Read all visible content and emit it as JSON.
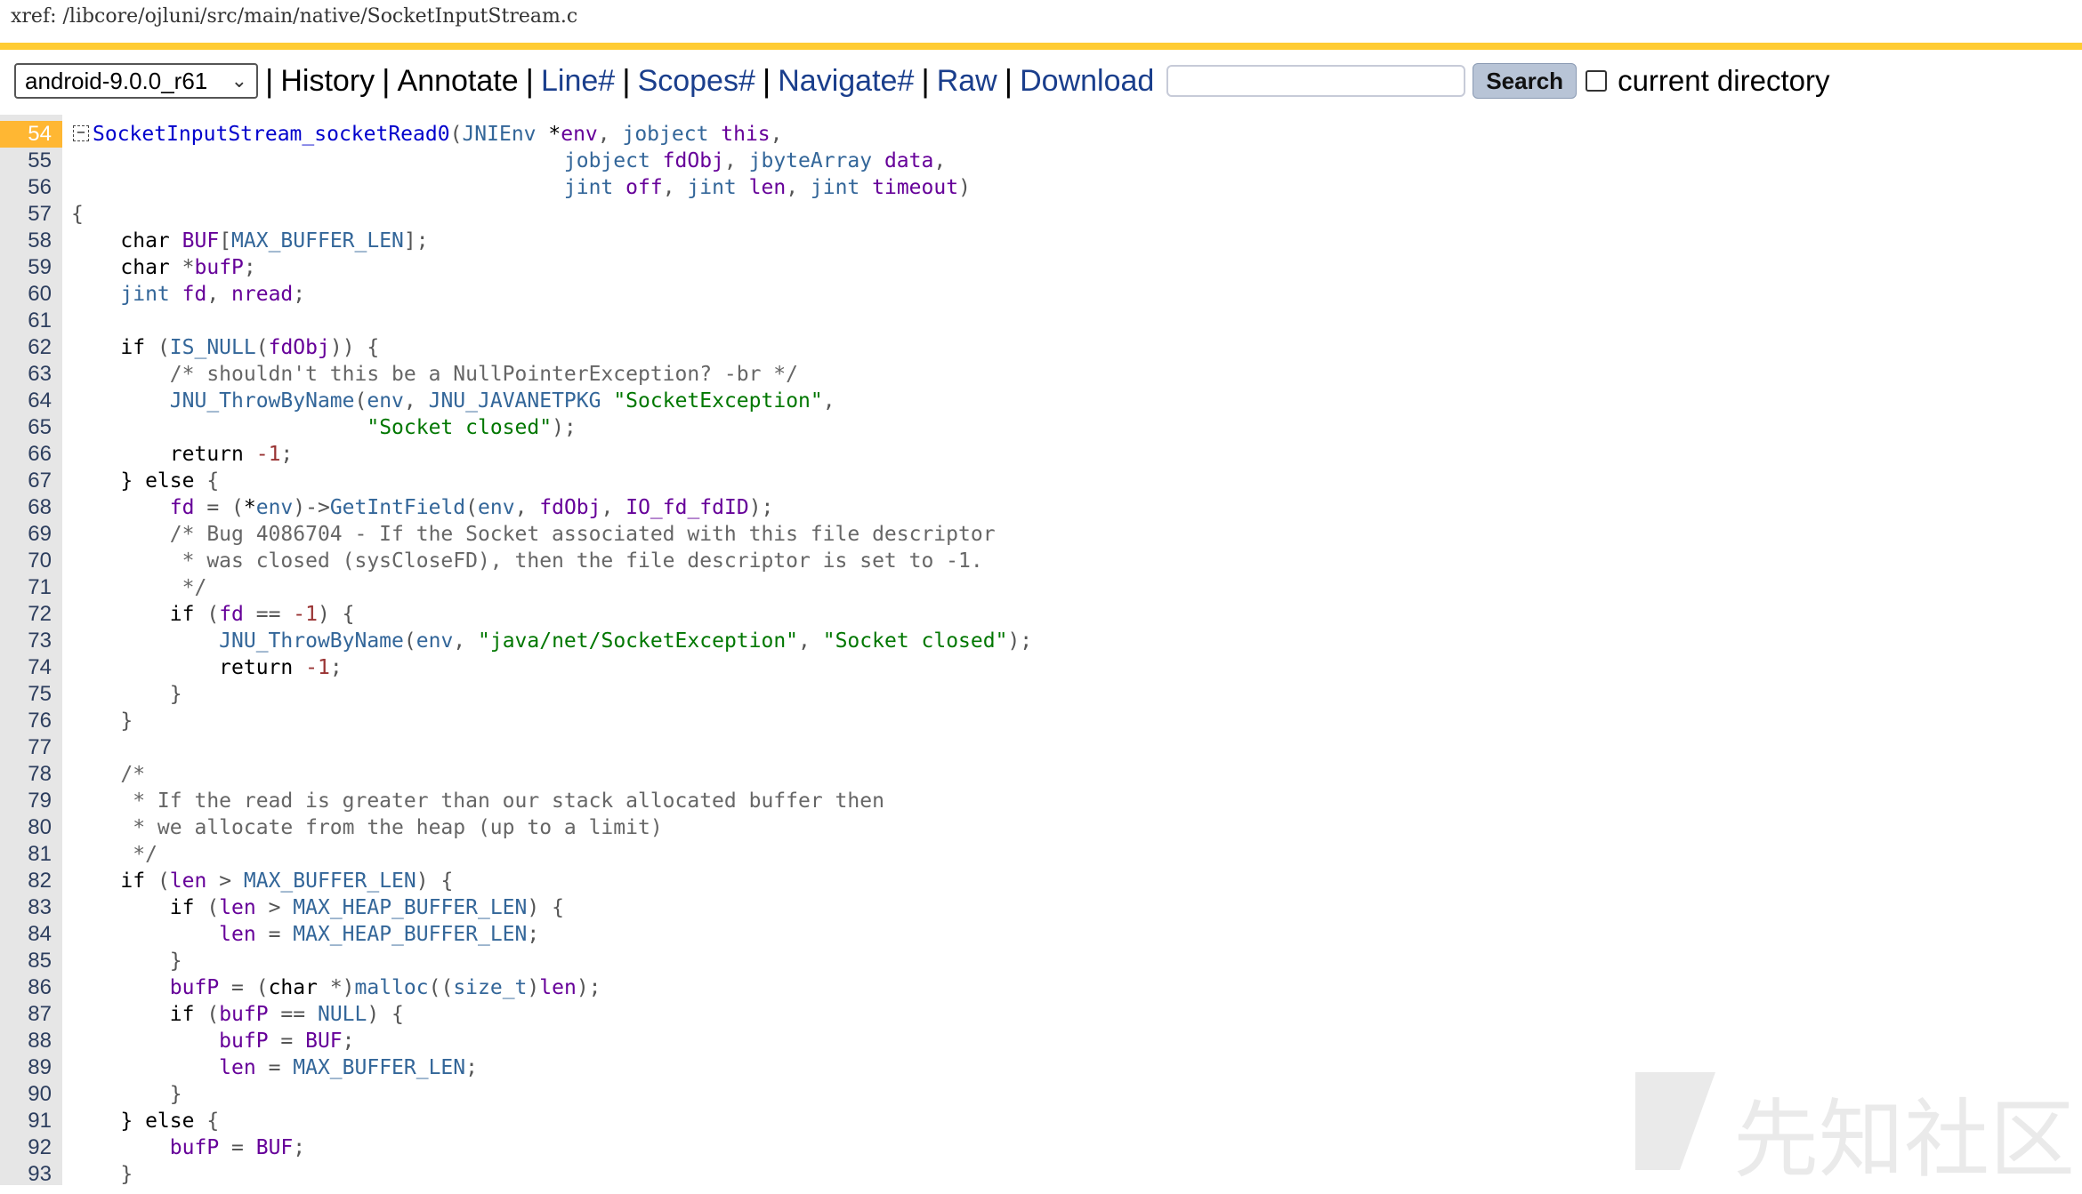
{
  "header": {
    "xref_path": "xref: /libcore/ojluni/src/main/native/SocketInputStream.c"
  },
  "nav": {
    "project_selected": "android-9.0.0_r61",
    "items": [
      "History",
      "Annotate"
    ],
    "links": [
      "Line#",
      "Scopes#",
      "Navigate#",
      "Raw",
      "Download"
    ],
    "search_placeholder": "",
    "search_button": "Search",
    "current_directory_label": "current directory"
  },
  "colors": {
    "accent_bar": "#ffcc33",
    "highlight_line": "#ffb733",
    "link": "#1a3e8c"
  },
  "code": {
    "highlight_line": 54,
    "lines": [
      {
        "n": "54",
        "tokens": [
          [
            "def",
            "SocketInputStream_socketRead0"
          ],
          [
            "pun",
            "("
          ],
          [
            "typ",
            "JNIEnv"
          ],
          [
            "kw",
            " *"
          ],
          [
            "id",
            "env"
          ],
          [
            "pun",
            ", "
          ],
          [
            "typ",
            "jobject "
          ],
          [
            "id",
            "this"
          ],
          [
            "pun",
            ","
          ]
        ]
      },
      {
        "n": "55",
        "tokens": [
          [
            "pun",
            "                                        "
          ],
          [
            "typ",
            "jobject "
          ],
          [
            "id",
            "fdObj"
          ],
          [
            "pun",
            ", "
          ],
          [
            "typ",
            "jbyteArray "
          ],
          [
            "id",
            "data"
          ],
          [
            "pun",
            ","
          ]
        ]
      },
      {
        "n": "56",
        "tokens": [
          [
            "pun",
            "                                        "
          ],
          [
            "typ",
            "jint "
          ],
          [
            "id",
            "off"
          ],
          [
            "pun",
            ", "
          ],
          [
            "typ",
            "jint "
          ],
          [
            "id",
            "len"
          ],
          [
            "pun",
            ", "
          ],
          [
            "typ",
            "jint "
          ],
          [
            "id",
            "timeout"
          ],
          [
            "pun",
            ")"
          ]
        ]
      },
      {
        "n": "57",
        "tokens": [
          [
            "pun",
            "{"
          ]
        ]
      },
      {
        "n": "58",
        "tokens": [
          [
            "pun",
            "    "
          ],
          [
            "kw",
            "char "
          ],
          [
            "id",
            "BUF"
          ],
          [
            "pun",
            "["
          ],
          [
            "mac",
            "MAX_BUFFER_LEN"
          ],
          [
            "pun",
            "];"
          ]
        ]
      },
      {
        "n": "59",
        "tokens": [
          [
            "pun",
            "    "
          ],
          [
            "kw",
            "char "
          ],
          [
            "pun",
            "*"
          ],
          [
            "id",
            "bufP"
          ],
          [
            "pun",
            ";"
          ]
        ]
      },
      {
        "n": "60",
        "tokens": [
          [
            "pun",
            "    "
          ],
          [
            "typ",
            "jint "
          ],
          [
            "id",
            "fd"
          ],
          [
            "pun",
            ", "
          ],
          [
            "id",
            "nread"
          ],
          [
            "pun",
            ";"
          ]
        ]
      },
      {
        "n": "61",
        "tokens": [
          [
            "pun",
            " "
          ]
        ]
      },
      {
        "n": "62",
        "tokens": [
          [
            "pun",
            "    "
          ],
          [
            "kw",
            "if "
          ],
          [
            "pun",
            "("
          ],
          [
            "mac",
            "IS_NULL"
          ],
          [
            "pun",
            "("
          ],
          [
            "id",
            "fdObj"
          ],
          [
            "pun",
            ")) {"
          ]
        ]
      },
      {
        "n": "63",
        "tokens": [
          [
            "pun",
            "        "
          ],
          [
            "com",
            "/* shouldn't this be a NullPointerException? -br */"
          ]
        ]
      },
      {
        "n": "64",
        "tokens": [
          [
            "pun",
            "        "
          ],
          [
            "mac",
            "JNU_ThrowByName"
          ],
          [
            "pun",
            "("
          ],
          [
            "typ",
            "env"
          ],
          [
            "pun",
            ", "
          ],
          [
            "mac",
            "JNU_JAVANETPKG "
          ],
          [
            "str",
            "\"SocketException\""
          ],
          [
            "pun",
            ","
          ]
        ]
      },
      {
        "n": "65",
        "tokens": [
          [
            "pun",
            "                        "
          ],
          [
            "str",
            "\"Socket closed\""
          ],
          [
            "pun",
            ");"
          ]
        ]
      },
      {
        "n": "66",
        "tokens": [
          [
            "pun",
            "        "
          ],
          [
            "kw",
            "return "
          ],
          [
            "num",
            "-1"
          ],
          [
            "pun",
            ";"
          ]
        ]
      },
      {
        "n": "67",
        "tokens": [
          [
            "pun",
            "    "
          ],
          [
            "kw",
            "} else "
          ],
          [
            "pun",
            "{"
          ]
        ]
      },
      {
        "n": "68",
        "tokens": [
          [
            "pun",
            "        "
          ],
          [
            "id",
            "fd"
          ],
          [
            "pun",
            " = ("
          ],
          [
            "kw",
            "*"
          ],
          [
            "typ",
            "env"
          ],
          [
            "pun",
            ")->"
          ],
          [
            "mac",
            "GetIntField"
          ],
          [
            "pun",
            "("
          ],
          [
            "typ",
            "env"
          ],
          [
            "pun",
            ", "
          ],
          [
            "id",
            "fdObj"
          ],
          [
            "pun",
            ", "
          ],
          [
            "id",
            "IO_fd_fdID"
          ],
          [
            "pun",
            ");"
          ]
        ]
      },
      {
        "n": "69",
        "tokens": [
          [
            "pun",
            "        "
          ],
          [
            "com",
            "/* Bug 4086704 - If the Socket associated with this file descriptor"
          ]
        ]
      },
      {
        "n": "70",
        "tokens": [
          [
            "pun",
            "        "
          ],
          [
            "com",
            " * was closed (sysCloseFD), then the file descriptor is set to -1."
          ]
        ]
      },
      {
        "n": "71",
        "tokens": [
          [
            "pun",
            "        "
          ],
          [
            "com",
            " */"
          ]
        ]
      },
      {
        "n": "72",
        "tokens": [
          [
            "pun",
            "        "
          ],
          [
            "kw",
            "if "
          ],
          [
            "pun",
            "("
          ],
          [
            "id",
            "fd"
          ],
          [
            "pun",
            " == "
          ],
          [
            "num",
            "-1"
          ],
          [
            "pun",
            ") {"
          ]
        ]
      },
      {
        "n": "73",
        "tokens": [
          [
            "pun",
            "            "
          ],
          [
            "mac",
            "JNU_ThrowByName"
          ],
          [
            "pun",
            "("
          ],
          [
            "typ",
            "env"
          ],
          [
            "pun",
            ", "
          ],
          [
            "str",
            "\"java/net/SocketException\""
          ],
          [
            "pun",
            ", "
          ],
          [
            "str",
            "\"Socket closed\""
          ],
          [
            "pun",
            ");"
          ]
        ]
      },
      {
        "n": "74",
        "tokens": [
          [
            "pun",
            "            "
          ],
          [
            "kw",
            "return "
          ],
          [
            "num",
            "-1"
          ],
          [
            "pun",
            ";"
          ]
        ]
      },
      {
        "n": "75",
        "tokens": [
          [
            "pun",
            "        }"
          ]
        ]
      },
      {
        "n": "76",
        "tokens": [
          [
            "pun",
            "    }"
          ]
        ]
      },
      {
        "n": "77",
        "tokens": [
          [
            "pun",
            " "
          ]
        ]
      },
      {
        "n": "78",
        "tokens": [
          [
            "pun",
            "    "
          ],
          [
            "com",
            "/*"
          ]
        ]
      },
      {
        "n": "79",
        "tokens": [
          [
            "pun",
            "    "
          ],
          [
            "com",
            " * If the read is greater than our stack allocated buffer then"
          ]
        ]
      },
      {
        "n": "80",
        "tokens": [
          [
            "pun",
            "    "
          ],
          [
            "com",
            " * we allocate from the heap (up to a limit)"
          ]
        ]
      },
      {
        "n": "81",
        "tokens": [
          [
            "pun",
            "    "
          ],
          [
            "com",
            " */"
          ]
        ]
      },
      {
        "n": "82",
        "tokens": [
          [
            "pun",
            "    "
          ],
          [
            "kw",
            "if "
          ],
          [
            "pun",
            "("
          ],
          [
            "id",
            "len"
          ],
          [
            "pun",
            " > "
          ],
          [
            "mac",
            "MAX_BUFFER_LEN"
          ],
          [
            "pun",
            ") {"
          ]
        ]
      },
      {
        "n": "83",
        "tokens": [
          [
            "pun",
            "        "
          ],
          [
            "kw",
            "if "
          ],
          [
            "pun",
            "("
          ],
          [
            "id",
            "len"
          ],
          [
            "pun",
            " > "
          ],
          [
            "mac",
            "MAX_HEAP_BUFFER_LEN"
          ],
          [
            "pun",
            ") {"
          ]
        ]
      },
      {
        "n": "84",
        "tokens": [
          [
            "pun",
            "            "
          ],
          [
            "id",
            "len"
          ],
          [
            "pun",
            " = "
          ],
          [
            "mac",
            "MAX_HEAP_BUFFER_LEN"
          ],
          [
            "pun",
            ";"
          ]
        ]
      },
      {
        "n": "85",
        "tokens": [
          [
            "pun",
            "        }"
          ]
        ]
      },
      {
        "n": "86",
        "tokens": [
          [
            "pun",
            "        "
          ],
          [
            "id",
            "bufP"
          ],
          [
            "pun",
            " = ("
          ],
          [
            "kw",
            "char "
          ],
          [
            "pun",
            "*)"
          ],
          [
            "mac",
            "malloc"
          ],
          [
            "pun",
            "(("
          ],
          [
            "typ",
            "size_t"
          ],
          [
            "pun",
            ")"
          ],
          [
            "id",
            "len"
          ],
          [
            "pun",
            ");"
          ]
        ]
      },
      {
        "n": "87",
        "tokens": [
          [
            "pun",
            "        "
          ],
          [
            "kw",
            "if "
          ],
          [
            "pun",
            "("
          ],
          [
            "id",
            "bufP"
          ],
          [
            "pun",
            " == "
          ],
          [
            "mac",
            "NULL"
          ],
          [
            "pun",
            ") {"
          ]
        ]
      },
      {
        "n": "88",
        "tokens": [
          [
            "pun",
            "            "
          ],
          [
            "id",
            "bufP"
          ],
          [
            "pun",
            " = "
          ],
          [
            "id",
            "BUF"
          ],
          [
            "pun",
            ";"
          ]
        ]
      },
      {
        "n": "89",
        "tokens": [
          [
            "pun",
            "            "
          ],
          [
            "id",
            "len"
          ],
          [
            "pun",
            " = "
          ],
          [
            "mac",
            "MAX_BUFFER_LEN"
          ],
          [
            "pun",
            ";"
          ]
        ]
      },
      {
        "n": "90",
        "tokens": [
          [
            "pun",
            "        }"
          ]
        ]
      },
      {
        "n": "91",
        "tokens": [
          [
            "pun",
            "    "
          ],
          [
            "kw",
            "} else "
          ],
          [
            "pun",
            "{"
          ]
        ]
      },
      {
        "n": "92",
        "tokens": [
          [
            "pun",
            "        "
          ],
          [
            "id",
            "bufP"
          ],
          [
            "pun",
            " = "
          ],
          [
            "id",
            "BUF"
          ],
          [
            "pun",
            ";"
          ]
        ]
      },
      {
        "n": "93",
        "tokens": [
          [
            "pun",
            "    }"
          ]
        ]
      }
    ]
  },
  "watermark": {
    "text": "先知社区",
    "icon": "xianzhi-logo-icon"
  }
}
